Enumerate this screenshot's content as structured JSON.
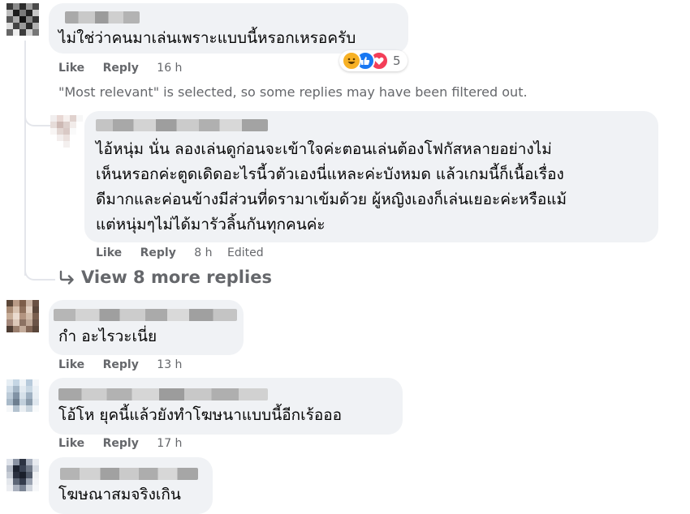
{
  "comments": [
    {
      "text": "ไม่ใช่ว่าคนมาเล่นเพราะแบบนี้หรอกเหรอครับ",
      "like": "Like",
      "reply": "Reply",
      "time": "16 h",
      "reaction_count": "5",
      "reactions": [
        "haha-icon",
        "like-icon",
        "love-icon"
      ]
    },
    {
      "text": "กำ อะไรวะเนี่ย",
      "like": "Like",
      "reply": "Reply",
      "time": "13 h"
    },
    {
      "text": "โอ้โห ยุคนี้แล้วยังทำโฆษนาแบบนี้อีกเร้อออ",
      "like": "Like",
      "reply": "Reply",
      "time": "17 h"
    },
    {
      "text": "โฆษณาสมจริงเกิน"
    }
  ],
  "filter_note": "\"Most relevant\" is selected, so some replies may have been filtered out.",
  "reply": {
    "lines": [
      "ไอ้หนุ่ม นั่น ลองเล่นดูก่อนจะเข้าใจค่ะตอนเล่นต้องโฟกัสหลายอย่างไม่",
      "เห็นหรอกค่ะตูดเดิดอะไรนี้วตัวเองนี่แหละค่ะบังหมด แล้วเกมนี้ก็เนื้อเรื่อง",
      "ดีมากและค่อนข้างมีส่วนที่ดรามาเข้มด้วย ผู้หญิงเองก็เล่นเยอะค่ะหรือแม้",
      "แต่หนุ่มๆไม่ได้มารัวลิ้นกันทุกคนค่ะ"
    ],
    "like": "Like",
    "reply": "Reply",
    "time": "8 h",
    "edited": "Edited"
  },
  "view_more": "View 8 more replies",
  "colors": {
    "bubble": "#f0f2f5",
    "secondary_text": "#65676b",
    "like_blue": "#1877f2",
    "love_red": "#f33e58",
    "haha_yellow": "#f7b125"
  }
}
